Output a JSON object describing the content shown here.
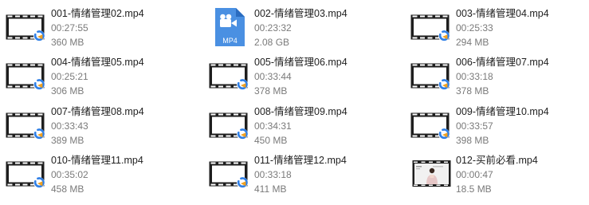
{
  "files": [
    {
      "name": "001-情绪管理02.mp4",
      "duration": "00:27:55",
      "size": "360 MB",
      "icon": "video-film-icon"
    },
    {
      "name": "002-情绪管理03.mp4",
      "duration": "00:23:32",
      "size": "2.08 GB",
      "icon": "mp4-document-icon",
      "badge": "MP4"
    },
    {
      "name": "003-情绪管理04.mp4",
      "duration": "00:25:33",
      "size": "294 MB",
      "icon": "video-film-icon"
    },
    {
      "name": "004-情绪管理05.mp4",
      "duration": "00:25:21",
      "size": "306 MB",
      "icon": "video-film-icon"
    },
    {
      "name": "005-情绪管理06.mp4",
      "duration": "00:33:44",
      "size": "378 MB",
      "icon": "video-film-icon"
    },
    {
      "name": "006-情绪管理07.mp4",
      "duration": "00:33:18",
      "size": "378 MB",
      "icon": "video-film-icon"
    },
    {
      "name": "007-情绪管理08.mp4",
      "duration": "00:33:43",
      "size": "389 MB",
      "icon": "video-film-icon"
    },
    {
      "name": "008-情绪管理09.mp4",
      "duration": "00:34:31",
      "size": "450 MB",
      "icon": "video-film-icon"
    },
    {
      "name": "009-情绪管理10.mp4",
      "duration": "00:33:57",
      "size": "398 MB",
      "icon": "video-film-icon"
    },
    {
      "name": "010-情绪管理11.mp4",
      "duration": "00:35:02",
      "size": "458 MB",
      "icon": "video-film-icon"
    },
    {
      "name": "011-情绪管理12.mp4",
      "duration": "00:33:18",
      "size": "411 MB",
      "icon": "video-film-icon"
    },
    {
      "name": "012-买前必看.mp4",
      "duration": "00:00:47",
      "size": "18.5 MB",
      "icon": "video-preview-thumbnail"
    }
  ]
}
